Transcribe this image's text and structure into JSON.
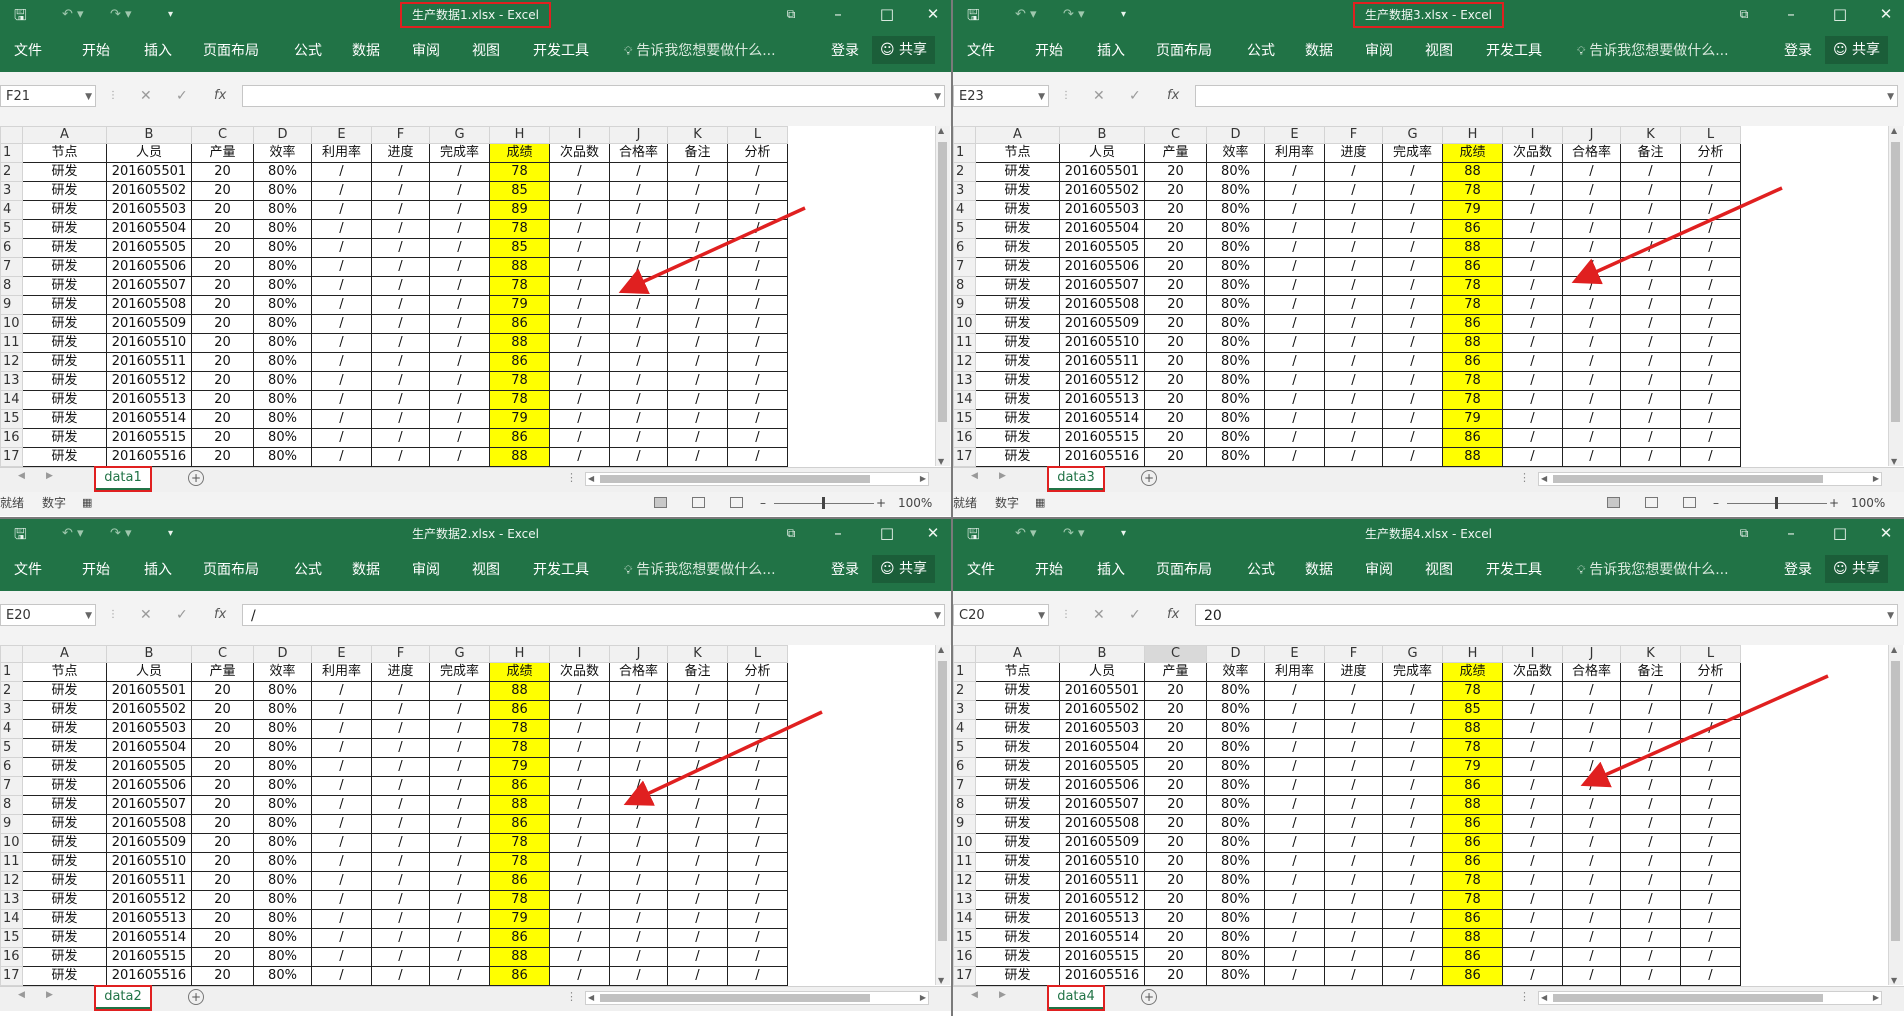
{
  "columns": [
    "A",
    "B",
    "C",
    "D",
    "E",
    "F",
    "G",
    "H",
    "I",
    "J",
    "K",
    "L"
  ],
  "header_row": [
    "节点",
    "人员",
    "产量",
    "效率",
    "利用率",
    "进度",
    "完成率",
    "成绩",
    "次品数",
    "合格率",
    "备注",
    "分析"
  ],
  "row_numbers": [
    "1",
    "2",
    "3",
    "4",
    "5",
    "6",
    "7",
    "8",
    "9",
    "10",
    "11",
    "12",
    "13",
    "14",
    "15",
    "16",
    "17"
  ],
  "common": {
    "node": "研发",
    "output": "20",
    "efficiency": "80%",
    "slash": "/",
    "staff": [
      "201605501",
      "201605502",
      "201605503",
      "201605504",
      "201605505",
      "201605506",
      "201605507",
      "201605508",
      "201605509",
      "201605510",
      "201605511",
      "201605512",
      "201605513",
      "201605514",
      "201605515",
      "201605516"
    ]
  },
  "ribbon_tabs": [
    "文件",
    "开始",
    "插入",
    "页面布局",
    "公式",
    "数据",
    "审阅",
    "视图",
    "开发工具"
  ],
  "tell_me": "告诉我您想要做什么...",
  "login": "登录",
  "share": "共享",
  "status_ready": "就绪",
  "status_num": "数字",
  "zoom": "100%",
  "colors": {
    "excel_green": "#217346",
    "highlight": "#ffff00",
    "annotation_red": "#e02020"
  },
  "windows": [
    {
      "title": "生产数据1.xlsx - Excel",
      "title_boxed": true,
      "namebox": "F21",
      "formula": "",
      "sheet": "data1",
      "selected_col": "",
      "scores": [
        "78",
        "85",
        "89",
        "78",
        "85",
        "88",
        "78",
        "79",
        "86",
        "88",
        "86",
        "78",
        "78",
        "79",
        "86",
        "88"
      ]
    },
    {
      "title": "生产数据3.xlsx - Excel",
      "title_boxed": true,
      "namebox": "E23",
      "formula": "",
      "sheet": "data3",
      "selected_col": "",
      "scores": [
        "88",
        "78",
        "79",
        "86",
        "88",
        "86",
        "78",
        "78",
        "86",
        "88",
        "86",
        "78",
        "78",
        "79",
        "86",
        "88"
      ]
    },
    {
      "title": "生产数据2.xlsx - Excel",
      "title_boxed": false,
      "namebox": "E20",
      "formula": "/",
      "sheet": "data2",
      "selected_col": "",
      "scores": [
        "88",
        "86",
        "78",
        "78",
        "79",
        "86",
        "88",
        "86",
        "78",
        "78",
        "86",
        "78",
        "79",
        "86",
        "88",
        "86"
      ]
    },
    {
      "title": "生产数据4.xlsx - Excel",
      "title_boxed": false,
      "namebox": "C20",
      "formula": "20",
      "sheet": "data4",
      "selected_col": "C",
      "scores": [
        "78",
        "85",
        "88",
        "78",
        "79",
        "86",
        "88",
        "86",
        "86",
        "86",
        "78",
        "78",
        "86",
        "88",
        "86",
        "86"
      ]
    }
  ]
}
